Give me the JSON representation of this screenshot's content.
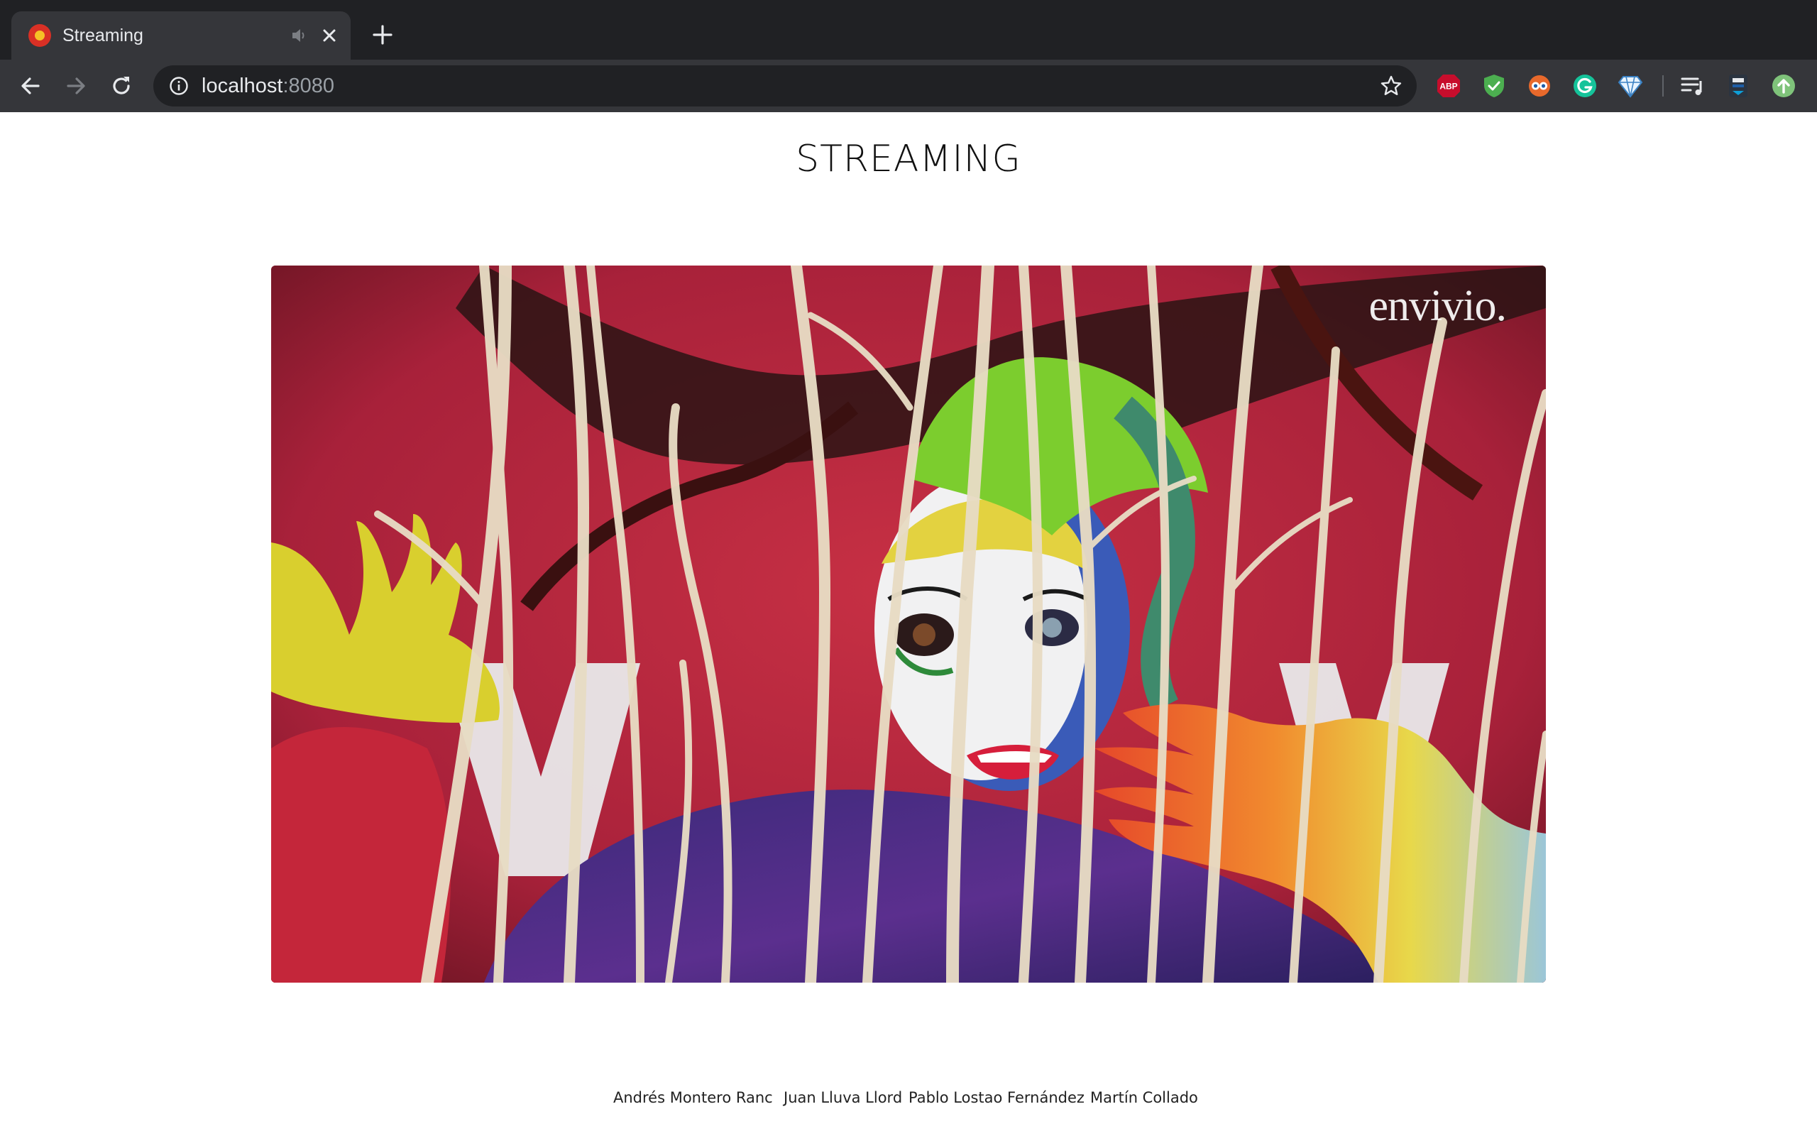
{
  "browser": {
    "tab": {
      "title": "Streaming",
      "favicon": "streaming-favicon-icon"
    },
    "new_tab_icon": "plus-icon",
    "nav": {
      "back_icon": "arrow-left-icon",
      "forward_icon": "arrow-right-icon",
      "reload_icon": "reload-icon"
    },
    "address_bar": {
      "host": "localhost",
      "port": ":8080",
      "info_icon": "info-icon",
      "bookmark_icon": "star-icon"
    },
    "extensions": [
      {
        "name": "adblock-plus-icon",
        "label": "ABP",
        "color": "#c70d2c"
      },
      {
        "name": "shield-check-icon",
        "color": "#4caf50"
      },
      {
        "name": "owl-extension-icon",
        "color": "#e8692b"
      },
      {
        "name": "grammarly-icon",
        "label": "G",
        "color": "#15c39a"
      },
      {
        "name": "diamond-icon",
        "color": "#e8f4ff"
      },
      {
        "name": "playlist-icon",
        "color": "#e8eaed"
      },
      {
        "name": "profile-extension-icon",
        "color": "#1f5fa8"
      },
      {
        "name": "upload-icon",
        "color": "#7fc37a"
      }
    ]
  },
  "page": {
    "title": "STREAMING",
    "video": {
      "watermark": "envivio."
    },
    "credits": [
      "Andrés Montero Ranc",
      "Juan Lluva Llord",
      "Pablo Lostao Fernández",
      "Martín Collado"
    ]
  },
  "colors": {
    "chrome_dark": "#202124",
    "chrome_mid": "#35363a",
    "page_bg": "#ffffff",
    "video_bg": "#b8293a"
  }
}
